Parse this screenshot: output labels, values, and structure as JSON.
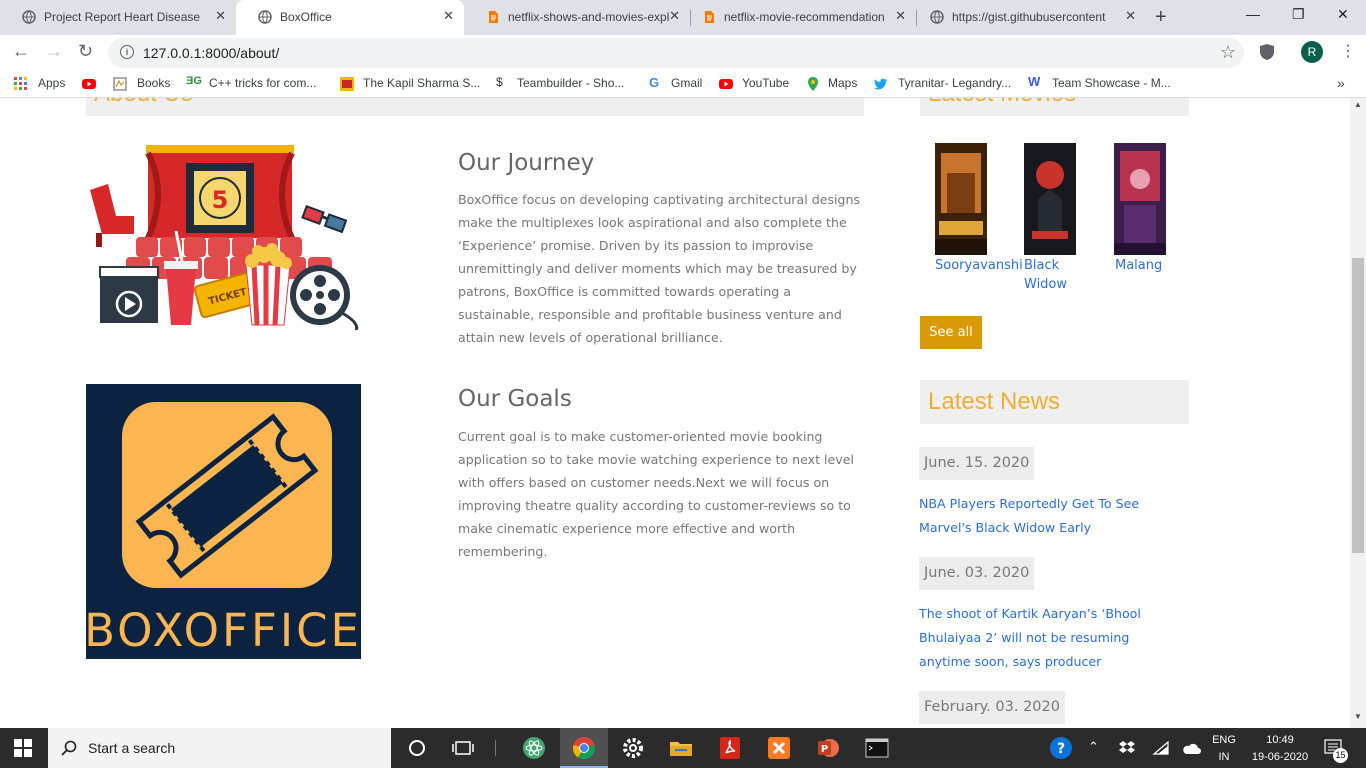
{
  "browser": {
    "tabs": [
      {
        "title": "Project Report Heart Disease P",
        "active": false
      },
      {
        "title": "BoxOffice",
        "active": true
      },
      {
        "title": "netflix-shows-and-movies-expl",
        "active": false
      },
      {
        "title": "netflix-movie-recommendation",
        "active": false
      },
      {
        "title": "https://gist.githubusercontent",
        "active": false
      }
    ],
    "url": "127.0.0.1:8000/about/",
    "profile_initial": "R",
    "bookmarks": [
      {
        "label": "Apps",
        "icon": "apps-grid-icon"
      },
      {
        "label": "",
        "icon": "youtube-icon"
      },
      {
        "label": "Books",
        "icon": "books-icon"
      },
      {
        "label": "C++ tricks for com...",
        "icon": "geeksforgeeks-icon"
      },
      {
        "label": "The Kapil Sharma S...",
        "icon": "tv-icon"
      },
      {
        "label": "Teambuilder - Sho...",
        "icon": "pokemon-showdown-icon"
      },
      {
        "label": "Gmail",
        "icon": "google-icon"
      },
      {
        "label": "YouTube",
        "icon": "youtube-icon"
      },
      {
        "label": "Maps",
        "icon": "maps-icon"
      },
      {
        "label": "Tyranitar- Legandry...",
        "icon": "twitter-icon"
      },
      {
        "label": "Team Showcase - M...",
        "icon": "w-icon"
      }
    ]
  },
  "page": {
    "about_heading": "About Us",
    "journey": {
      "title": "Our Journey",
      "text": "BoxOffice focus on developing captivating architectural designs make the multiplexes look aspirational and also complete the ‘Experience’ promise. Driven by its passion to improvise unremittingly and deliver moments which may be treasured by patrons, BoxOffice is committed towards operating a sustainable, responsible and profitable business venture and attain new levels of operational brilliance."
    },
    "goals": {
      "title": "Our Goals",
      "text": "Current goal is to make customer-oriented movie booking application so to take movie watching experience to next level with offers based on customer needs.Next we will focus on improving theatre quality according to customer-reviews so to make cinematic experience more effective and worth remembering."
    },
    "logo_text": "BOXOFFICE",
    "poster_numeral": "5",
    "ticket_text": "TICKET",
    "latest_movies": {
      "heading": "Latest Movies",
      "movies": [
        {
          "title": "Sooryavanshi"
        },
        {
          "title": "Black Widow"
        },
        {
          "title": "Malang"
        }
      ],
      "see_all": "See all"
    },
    "latest_news": {
      "heading": "Latest News",
      "items": [
        {
          "date": "June. 15. 2020",
          "headline": "NBA Players Reportedly Get To See Marvel's Black Widow Early"
        },
        {
          "date": "June. 03. 2020",
          "headline": "The shoot of Kartik Aaryan’s ‘Bhool Bhulaiyaa 2’ will not be resuming anytime soon, says producer"
        },
        {
          "date": "February. 03. 2020",
          "headline": ""
        }
      ]
    }
  },
  "taskbar": {
    "search_placeholder": "Start a search",
    "lang": "ENG",
    "region": "IN",
    "time": "10:49",
    "date": "19-06-2020",
    "notifications": "15"
  }
}
